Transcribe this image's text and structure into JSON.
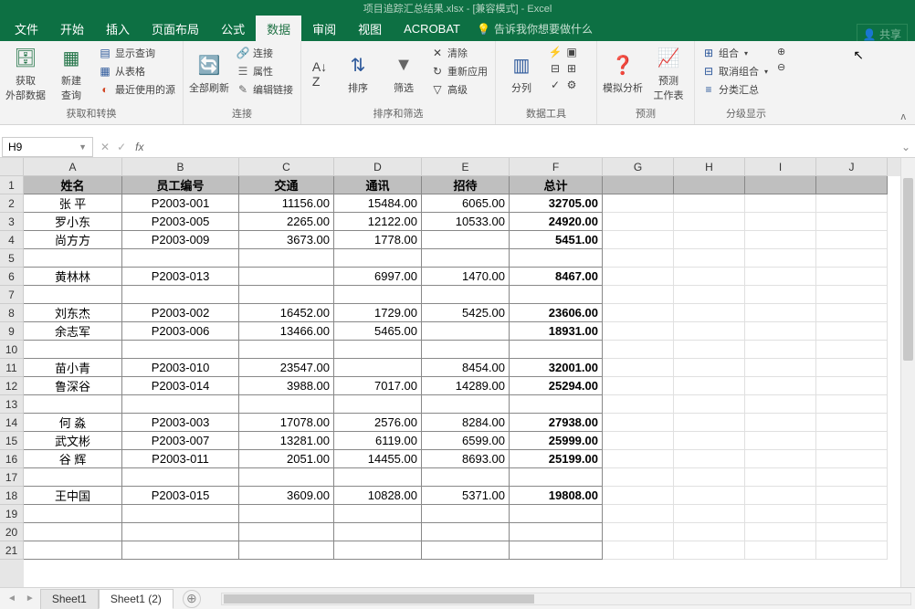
{
  "titlebar": {
    "text": "项目追踪汇总结果.xlsx - [兼容模式] - Excel"
  },
  "tabs": {
    "items": [
      "文件",
      "开始",
      "插入",
      "页面布局",
      "公式",
      "数据",
      "审阅",
      "视图",
      "ACROBAT"
    ],
    "active": "数据",
    "tell_me": "告诉我你想要做什么",
    "share": "共享"
  },
  "ribbon": {
    "groups": [
      {
        "label": "获取和转换",
        "items": [
          "获取\n外部数据",
          "新建\n查询",
          "显示查询",
          "从表格",
          "最近使用的源"
        ]
      },
      {
        "label": "连接",
        "items": [
          "全部刷新",
          "连接",
          "属性",
          "编辑链接"
        ]
      },
      {
        "label": "排序和筛选",
        "items": [
          "排序",
          "筛选",
          "清除",
          "重新应用",
          "高级"
        ]
      },
      {
        "label": "数据工具",
        "items": [
          "分列"
        ]
      },
      {
        "label": "预测",
        "items": [
          "模拟分析",
          "预测\n工作表"
        ]
      },
      {
        "label": "分级显示",
        "items": [
          "组合",
          "取消组合",
          "分类汇总"
        ]
      }
    ]
  },
  "namebox": {
    "value": "H9"
  },
  "columns": [
    "A",
    "B",
    "C",
    "D",
    "E",
    "F",
    "G",
    "H",
    "I",
    "J"
  ],
  "colwidths": [
    "col-A",
    "col-B",
    "col-C",
    "col-D",
    "col-E",
    "col-F",
    "col-G",
    "col-H",
    "col-I",
    "col-J"
  ],
  "header_row": [
    "姓名",
    "员工编号",
    "交通",
    "通讯",
    "招待",
    "总计"
  ],
  "chart_data": {
    "type": "table",
    "columns": [
      "姓名",
      "员工编号",
      "交通",
      "通讯",
      "招待",
      "总计"
    ],
    "rows": [
      [
        "张  平",
        "P2003-001",
        "11156.00",
        "15484.00",
        "6065.00",
        "32705.00"
      ],
      [
        "罗小东",
        "P2003-005",
        "2265.00",
        "12122.00",
        "10533.00",
        "24920.00"
      ],
      [
        "尚方方",
        "P2003-009",
        "3673.00",
        "1778.00",
        "",
        "5451.00"
      ],
      [
        "",
        "",
        "",
        "",
        "",
        ""
      ],
      [
        "黄林林",
        "P2003-013",
        "",
        "6997.00",
        "1470.00",
        "8467.00"
      ],
      [
        "",
        "",
        "",
        "",
        "",
        ""
      ],
      [
        "刘东杰",
        "P2003-002",
        "16452.00",
        "1729.00",
        "5425.00",
        "23606.00"
      ],
      [
        "余志军",
        "P2003-006",
        "13466.00",
        "5465.00",
        "",
        "18931.00"
      ],
      [
        "",
        "",
        "",
        "",
        "",
        ""
      ],
      [
        "苗小青",
        "P2003-010",
        "23547.00",
        "",
        "8454.00",
        "32001.00"
      ],
      [
        "鲁深谷",
        "P2003-014",
        "3988.00",
        "7017.00",
        "14289.00",
        "25294.00"
      ],
      [
        "",
        "",
        "",
        "",
        "",
        ""
      ],
      [
        "何  淼",
        "P2003-003",
        "17078.00",
        "2576.00",
        "8284.00",
        "27938.00"
      ],
      [
        "武文彬",
        "P2003-007",
        "13281.00",
        "6119.00",
        "6599.00",
        "25999.00"
      ],
      [
        "谷  辉",
        "P2003-011",
        "2051.00",
        "14455.00",
        "8693.00",
        "25199.00"
      ],
      [
        "",
        "",
        "",
        "",
        "",
        ""
      ],
      [
        "王中国",
        "P2003-015",
        "3609.00",
        "10828.00",
        "5371.00",
        "19808.00"
      ]
    ]
  },
  "row_count": 21,
  "sheets": {
    "tabs": [
      "Sheet1",
      "Sheet1 (2)"
    ],
    "active": "Sheet1 (2)"
  }
}
